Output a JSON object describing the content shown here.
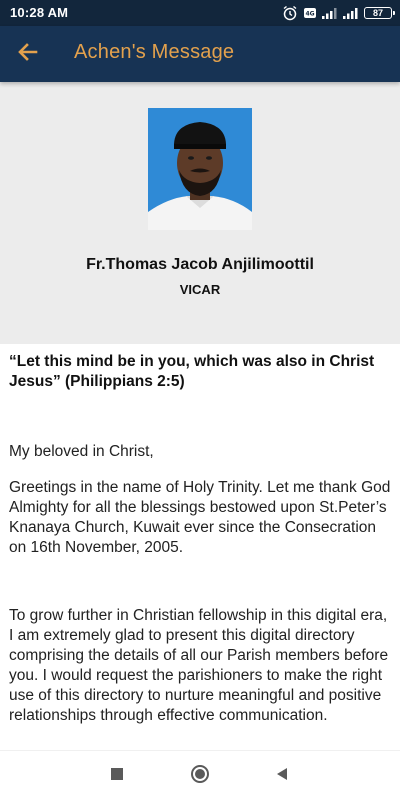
{
  "status_bar": {
    "time": "10:28 AM",
    "battery": "87",
    "icons": [
      "alarm-icon",
      "sim-icon",
      "signal-icon",
      "signal-icon-2",
      "battery-icon"
    ]
  },
  "app_bar": {
    "title": "Achen's Message",
    "back_icon": "back-arrow-icon",
    "title_color": "#e3a14d",
    "background": "#173354"
  },
  "profile": {
    "name": "Fr.Thomas Jacob Anjilimoottil",
    "role": "VICAR"
  },
  "message": {
    "quote": "“Let this mind be in you, which was also in Christ Jesus”  (Philippians 2:5)",
    "salutation": "My beloved in Christ,",
    "paragraph_1": "Greetings in the name of Holy Trinity.  Let me thank God Almighty for all the blessings bestowed upon St.Peter’s Knanaya Church, Kuwait ever since the Consecration on 16th November, 2005.",
    "paragraph_2": "To grow further in Christian fellowship in this digital era, I am extremely glad to present this digital directory comprising the details of all our Parish members before you. I would request the parishioners to make the right use of this directory to nurture meaningful and positive relationships through effective communication."
  },
  "nav_bar": {
    "icons": [
      "recent-apps-icon",
      "home-icon",
      "back-icon"
    ]
  }
}
